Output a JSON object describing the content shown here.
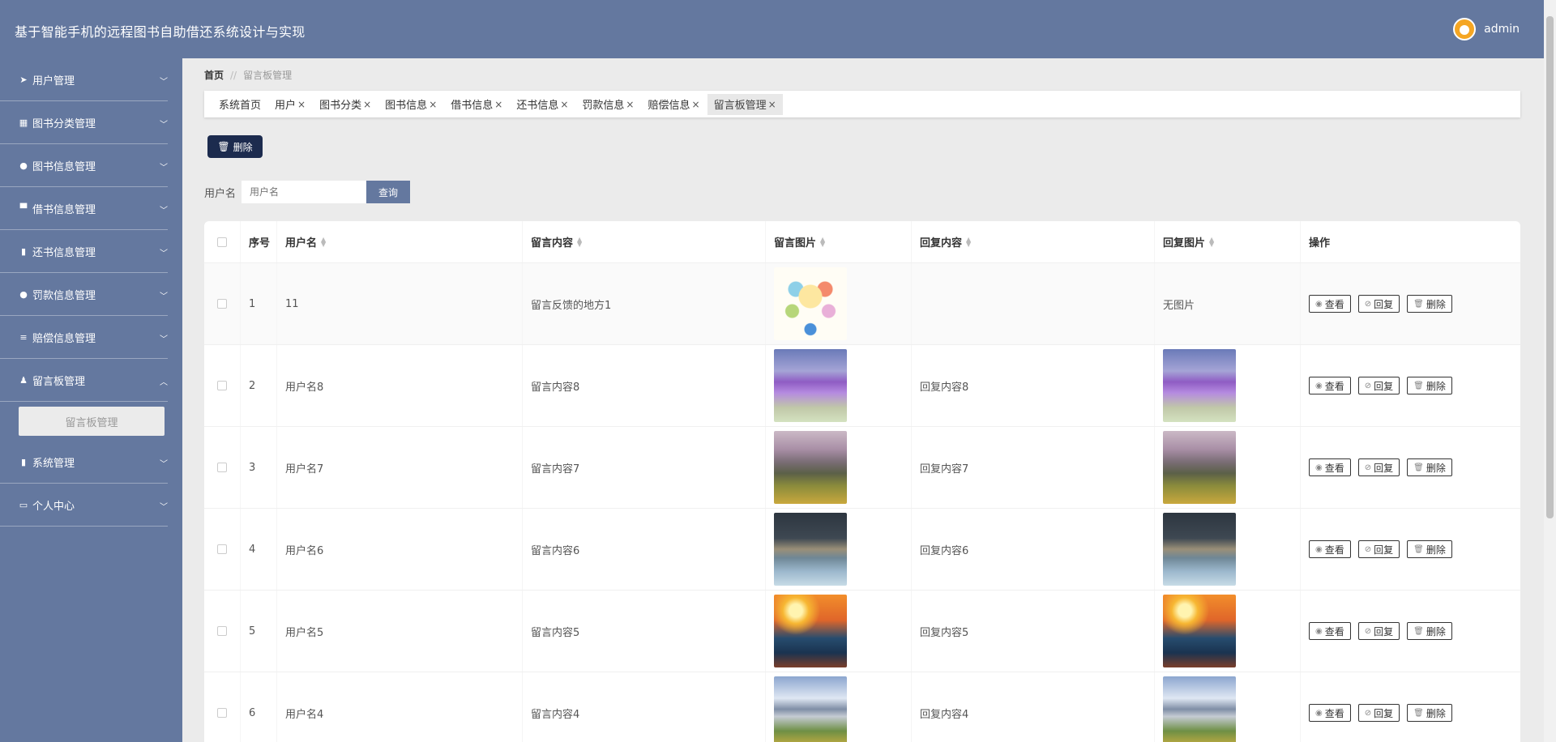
{
  "header": {
    "title": "基于智能手机的远程图书自助借还系统设计与实现",
    "username": "admin"
  },
  "sidebar": {
    "items": [
      {
        "label": "用户管理",
        "icon": "send-icon"
      },
      {
        "label": "图书分类管理",
        "icon": "grid-icon"
      },
      {
        "label": "图书信息管理",
        "icon": "pin-icon"
      },
      {
        "label": "借书信息管理",
        "icon": "podium-icon"
      },
      {
        "label": "还书信息管理",
        "icon": "clipboard-icon"
      },
      {
        "label": "罚款信息管理",
        "icon": "user-icon"
      },
      {
        "label": "赔偿信息管理",
        "icon": "list-icon"
      },
      {
        "label": "留言板管理",
        "icon": "user-stamp-icon"
      },
      {
        "label": "系统管理",
        "icon": "clipboard-icon"
      },
      {
        "label": "个人中心",
        "icon": "card-icon"
      }
    ],
    "submenu_label": "留言板管理"
  },
  "breadcrumb": {
    "home": "首页",
    "separator": "//",
    "current": "留言板管理"
  },
  "tabs": [
    {
      "label": "系统首页"
    },
    {
      "label": "用户"
    },
    {
      "label": "图书分类"
    },
    {
      "label": "图书信息"
    },
    {
      "label": "借书信息"
    },
    {
      "label": "还书信息"
    },
    {
      "label": "罚款信息"
    },
    {
      "label": "赔偿信息"
    },
    {
      "label": "留言板管理"
    }
  ],
  "toolbar": {
    "delete_label": "删除"
  },
  "search": {
    "label": "用户名",
    "placeholder": "用户名",
    "button": "查询"
  },
  "table": {
    "headers": [
      "序号",
      "用户名",
      "留言内容",
      "留言图片",
      "回复内容",
      "回复图片",
      "操作"
    ],
    "actions": {
      "view": "查看",
      "reply": "回复",
      "delete": "删除"
    },
    "rows": [
      {
        "no": "1",
        "user": "11",
        "content": "留言反馈的地方1",
        "reply": "",
        "reply_pic_text": "无图片"
      },
      {
        "no": "2",
        "user": "用户名8",
        "content": "留言内容8",
        "reply": "回复内容8",
        "reply_pic_text": ""
      },
      {
        "no": "3",
        "user": "用户名7",
        "content": "留言内容7",
        "reply": "回复内容7",
        "reply_pic_text": ""
      },
      {
        "no": "4",
        "user": "用户名6",
        "content": "留言内容6",
        "reply": "回复内容6",
        "reply_pic_text": ""
      },
      {
        "no": "5",
        "user": "用户名5",
        "content": "留言内容5",
        "reply": "回复内容5",
        "reply_pic_text": ""
      },
      {
        "no": "6",
        "user": "用户名4",
        "content": "留言内容4",
        "reply": "回复内容4",
        "reply_pic_text": ""
      }
    ]
  },
  "colors": {
    "primary": "#64789f",
    "dark_button": "#1c2b4e",
    "background": "#ebebeb"
  }
}
